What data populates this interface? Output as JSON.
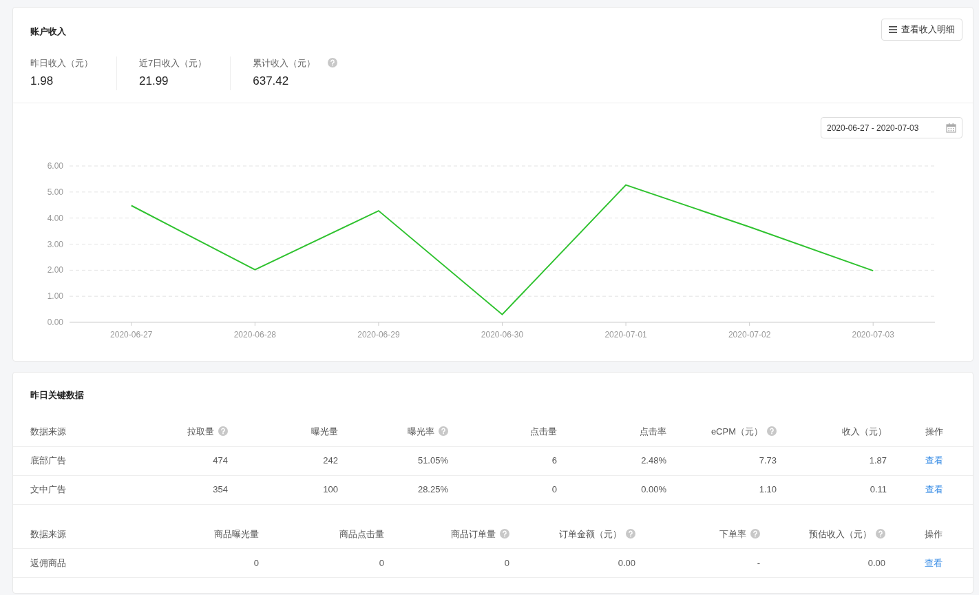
{
  "account_income": {
    "title": "账户收入",
    "detail_button": "查看收入明细",
    "stats": [
      {
        "label": "昨日收入（元）",
        "value": "1.98",
        "help": false
      },
      {
        "label": "近7日收入（元）",
        "value": "21.99",
        "help": false
      },
      {
        "label": "累计收入（元）",
        "value": "637.42",
        "help": true
      }
    ],
    "date_range": {
      "value": "2020-06-27 - 2020-07-03"
    },
    "chart_data": {
      "type": "line",
      "categories": [
        "2020-06-27",
        "2020-06-28",
        "2020-06-29",
        "2020-06-30",
        "2020-07-01",
        "2020-07-02",
        "2020-07-03"
      ],
      "grid": true,
      "series": [
        {
          "color": "#2fc22f",
          "values": [
            4.48,
            2.02,
            4.28,
            0.3,
            5.27,
            3.66,
            1.98
          ]
        }
      ],
      "ylim": [
        0,
        6
      ],
      "yticks": [
        {
          "value": 0,
          "label": "0.00"
        },
        {
          "value": 1,
          "label": "1.00"
        },
        {
          "value": 2,
          "label": "2.00"
        },
        {
          "value": 3,
          "label": "3.00"
        },
        {
          "value": 4,
          "label": "4.00"
        },
        {
          "value": 5,
          "label": "5.00"
        },
        {
          "value": 6,
          "label": "6.00"
        }
      ]
    }
  },
  "key_data": {
    "title": "昨日关键数据",
    "ad_table": {
      "columns": [
        {
          "label": "数据来源",
          "help": false
        },
        {
          "label": "拉取量",
          "help": true
        },
        {
          "label": "曝光量",
          "help": false
        },
        {
          "label": "曝光率",
          "help": true
        },
        {
          "label": "点击量",
          "help": false
        },
        {
          "label": "点击率",
          "help": false
        },
        {
          "label": "eCPM（元）",
          "help": true
        },
        {
          "label": "收入（元）",
          "help": false
        },
        {
          "label": "操作",
          "help": false
        }
      ],
      "rows": [
        {
          "cells": [
            "底部广告",
            "474",
            "242",
            "51.05%",
            "6",
            "2.48%",
            "7.73",
            "1.87"
          ],
          "action": "查看"
        },
        {
          "cells": [
            "文中广告",
            "354",
            "100",
            "28.25%",
            "0",
            "0.00%",
            "1.10",
            "0.11"
          ],
          "action": "查看"
        }
      ]
    },
    "product_table": {
      "columns": [
        {
          "label": "数据来源",
          "help": false
        },
        {
          "label": "商品曝光量",
          "help": false
        },
        {
          "label": "商品点击量",
          "help": false
        },
        {
          "label": "商品订单量",
          "help": true
        },
        {
          "label": "订单金额（元）",
          "help": true
        },
        {
          "label": "下单率",
          "help": true
        },
        {
          "label": "预估收入（元）",
          "help": true
        },
        {
          "label": "操作",
          "help": false
        }
      ],
      "rows": [
        {
          "cells": [
            "返佣商品",
            "0",
            "0",
            "0",
            "0.00",
            "-",
            "0.00"
          ],
          "action": "查看"
        }
      ]
    }
  }
}
